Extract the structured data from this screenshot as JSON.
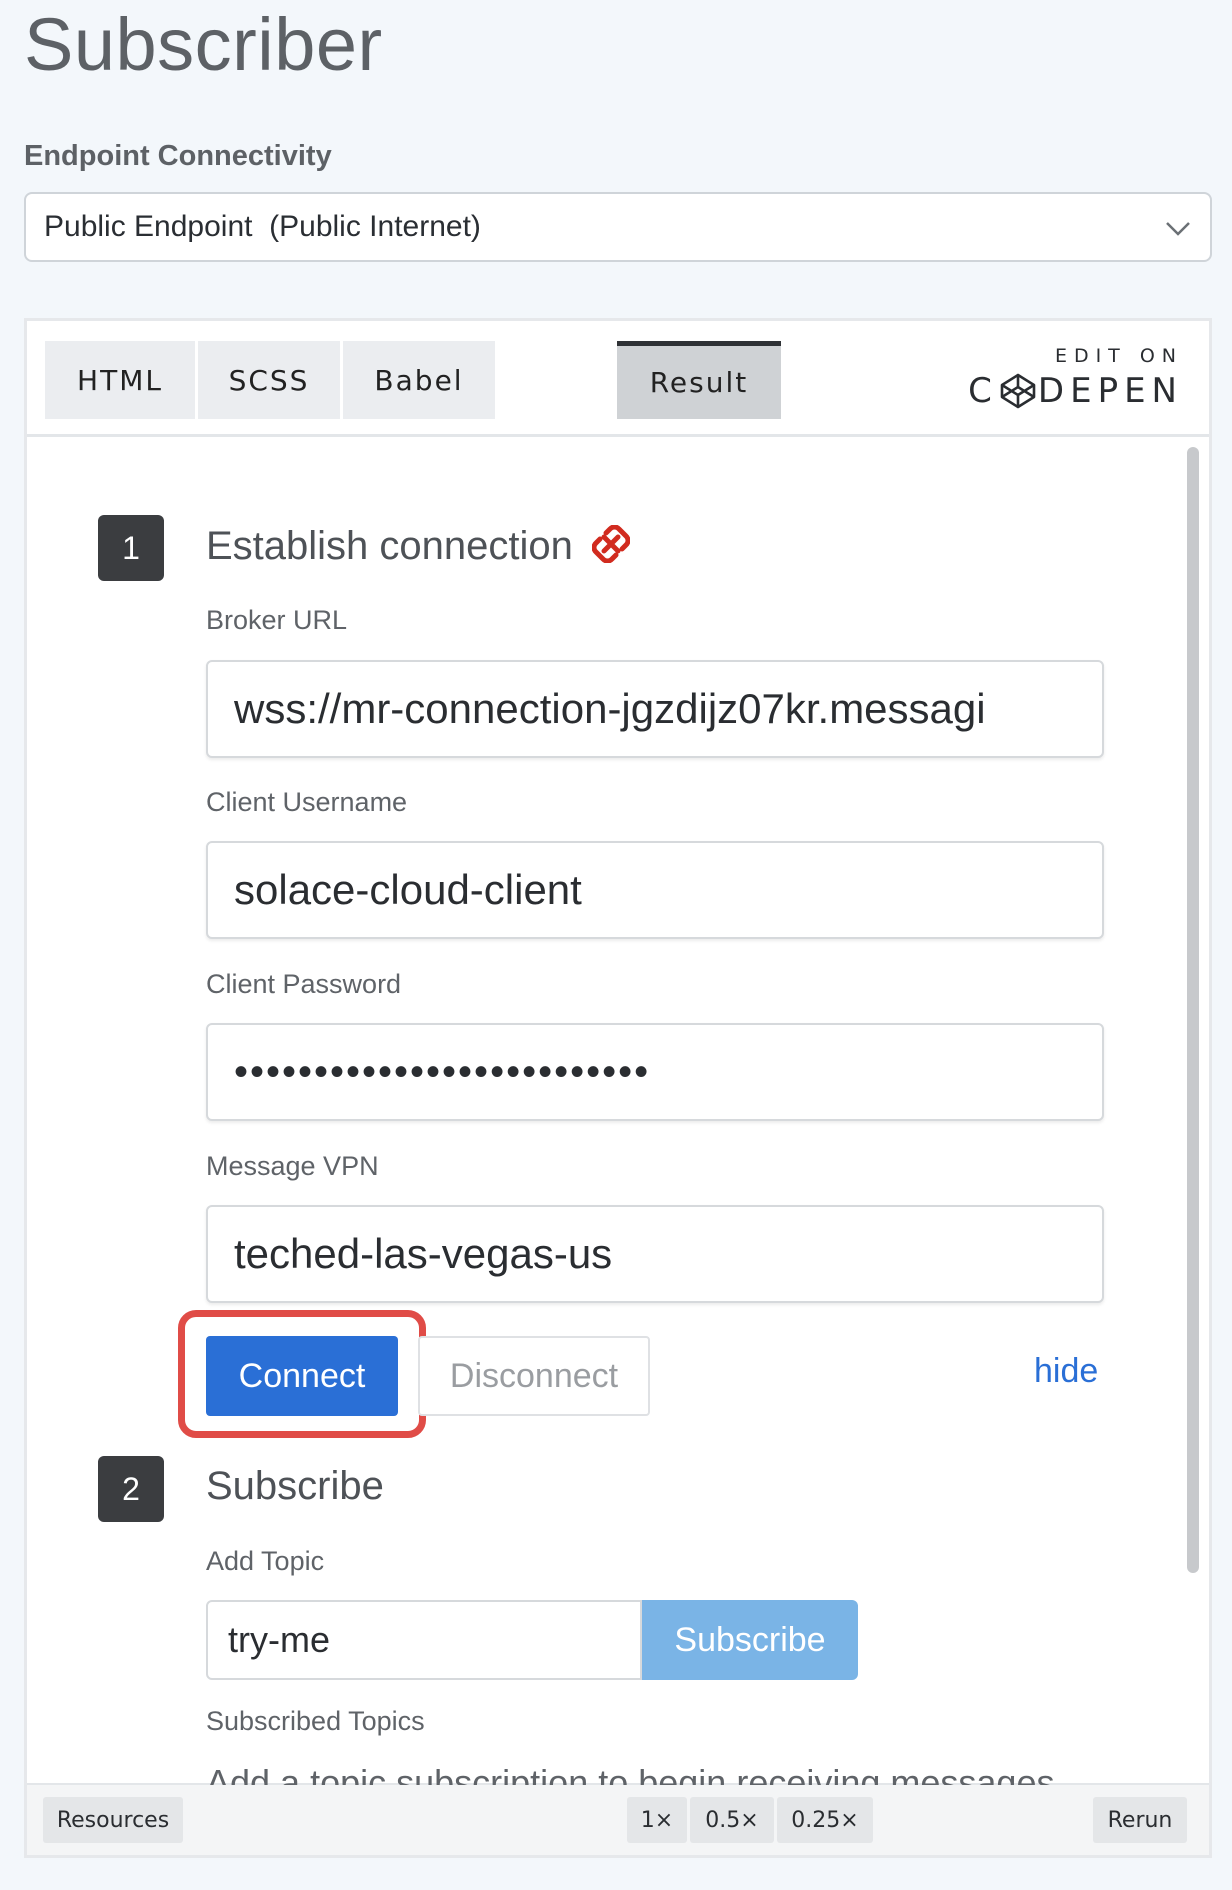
{
  "page": {
    "title": "Subscriber"
  },
  "endpoint": {
    "label": "Endpoint Connectivity",
    "selected": "Public Endpoint  (Public Internet)"
  },
  "embed": {
    "tabs": [
      {
        "label": "HTML"
      },
      {
        "label": "SCSS"
      },
      {
        "label": "Babel"
      },
      {
        "label": "Result",
        "active": true
      }
    ],
    "brand": {
      "edit_on": "EDIT ON",
      "logo_left": "C",
      "logo_right": "DEPEN"
    },
    "footer": {
      "resources": "Resources",
      "zoom": [
        "1×",
        "0.5×",
        "0.25×"
      ],
      "rerun": "Rerun"
    }
  },
  "step1": {
    "number": "1",
    "title": "Establish connection",
    "status_icon": "broken-link-icon",
    "status_color": "#d12b1f",
    "fields": [
      {
        "label": "Broker URL",
        "value": "wss://mr-connection-jgzdijz07kr.messagi"
      },
      {
        "label": "Client Username",
        "value": "solace-cloud-client"
      },
      {
        "label": "Client Password",
        "value": "••••••••••••••••••••••••••"
      },
      {
        "label": "Message VPN",
        "value": "teched-las-vegas-us"
      }
    ],
    "connect_label": "Connect",
    "disconnect_label": "Disconnect",
    "hide_label": "hide"
  },
  "step2": {
    "number": "2",
    "title": "Subscribe",
    "add_topic_label": "Add Topic",
    "topic_value": "try-me",
    "subscribe_label": "Subscribe",
    "subscribed_label": "Subscribed Topics",
    "empty_message": "Add a topic subscription to begin receiving messages"
  },
  "colors": {
    "primary": "#2a6fd6",
    "subscribe_disabled": "#7ab4e6",
    "highlight": "#e04c47"
  }
}
